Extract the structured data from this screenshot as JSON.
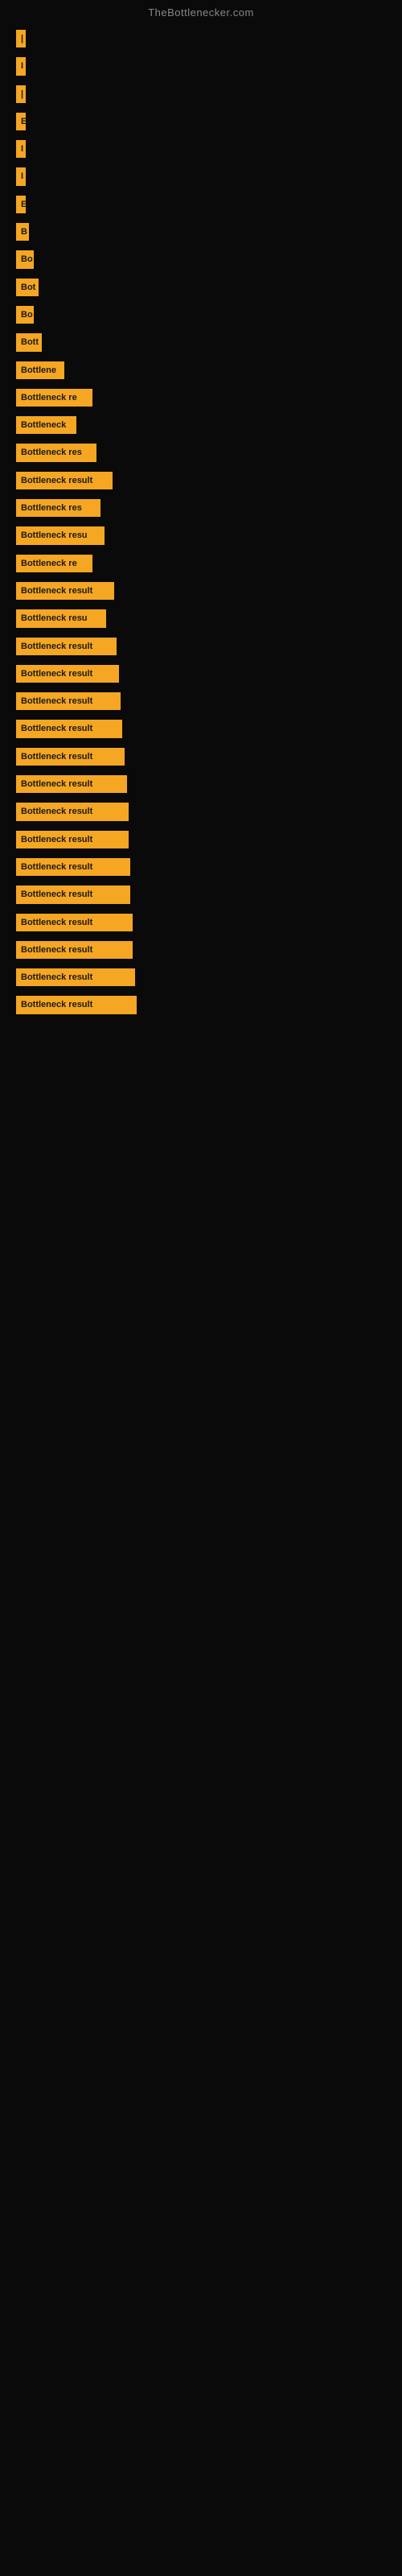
{
  "site": {
    "title": "TheBottlenecker.com"
  },
  "bars": [
    {
      "id": 1,
      "label": "|",
      "width": 8
    },
    {
      "id": 2,
      "label": "I",
      "width": 10
    },
    {
      "id": 3,
      "label": "|",
      "width": 8
    },
    {
      "id": 4,
      "label": "E",
      "width": 12
    },
    {
      "id": 5,
      "label": "I",
      "width": 10
    },
    {
      "id": 6,
      "label": "I",
      "width": 10
    },
    {
      "id": 7,
      "label": "E",
      "width": 12
    },
    {
      "id": 8,
      "label": "B",
      "width": 16
    },
    {
      "id": 9,
      "label": "Bo",
      "width": 22
    },
    {
      "id": 10,
      "label": "Bot",
      "width": 28
    },
    {
      "id": 11,
      "label": "Bo",
      "width": 22
    },
    {
      "id": 12,
      "label": "Bott",
      "width": 32
    },
    {
      "id": 13,
      "label": "Bottlene",
      "width": 60
    },
    {
      "id": 14,
      "label": "Bottleneck re",
      "width": 95
    },
    {
      "id": 15,
      "label": "Bottleneck",
      "width": 75
    },
    {
      "id": 16,
      "label": "Bottleneck res",
      "width": 100
    },
    {
      "id": 17,
      "label": "Bottleneck result",
      "width": 120
    },
    {
      "id": 18,
      "label": "Bottleneck res",
      "width": 105
    },
    {
      "id": 19,
      "label": "Bottleneck resu",
      "width": 110
    },
    {
      "id": 20,
      "label": "Bottleneck re",
      "width": 95
    },
    {
      "id": 21,
      "label": "Bottleneck result",
      "width": 122
    },
    {
      "id": 22,
      "label": "Bottleneck resu",
      "width": 112
    },
    {
      "id": 23,
      "label": "Bottleneck result",
      "width": 125
    },
    {
      "id": 24,
      "label": "Bottleneck result",
      "width": 128
    },
    {
      "id": 25,
      "label": "Bottleneck result",
      "width": 130
    },
    {
      "id": 26,
      "label": "Bottleneck result",
      "width": 132
    },
    {
      "id": 27,
      "label": "Bottleneck result",
      "width": 135
    },
    {
      "id": 28,
      "label": "Bottleneck result",
      "width": 138
    },
    {
      "id": 29,
      "label": "Bottleneck result",
      "width": 140
    },
    {
      "id": 30,
      "label": "Bottleneck result",
      "width": 140
    },
    {
      "id": 31,
      "label": "Bottleneck result",
      "width": 142
    },
    {
      "id": 32,
      "label": "Bottleneck result",
      "width": 142
    },
    {
      "id": 33,
      "label": "Bottleneck result",
      "width": 145
    },
    {
      "id": 34,
      "label": "Bottleneck result",
      "width": 145
    },
    {
      "id": 35,
      "label": "Bottleneck result",
      "width": 148
    },
    {
      "id": 36,
      "label": "Bottleneck result",
      "width": 150
    }
  ]
}
